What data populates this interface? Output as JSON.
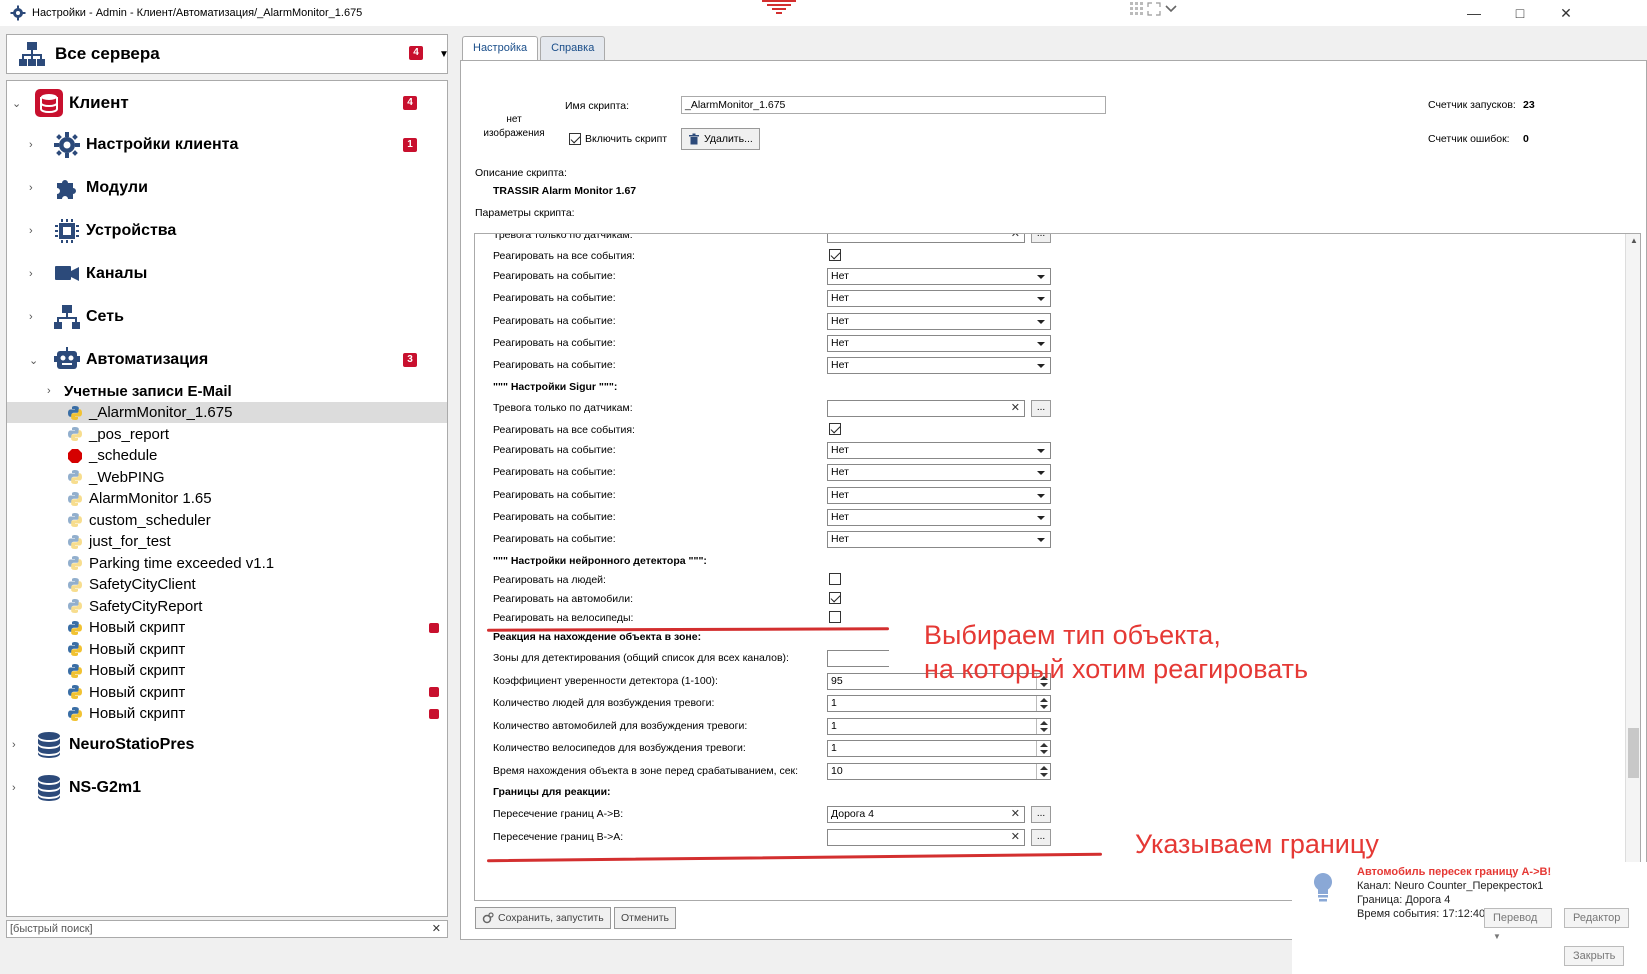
{
  "window": {
    "title": "Настройки - Admin - Клиент/Автоматизация/_AlarmMonitor_1.675"
  },
  "left_top": {
    "label": "Все сервера",
    "badge": "4"
  },
  "tree": {
    "client": {
      "label": "Клиент",
      "badge": "4"
    },
    "client_settings": {
      "label": "Настройки клиента",
      "badge": "1"
    },
    "modules": {
      "label": "Модули"
    },
    "devices": {
      "label": "Устройства"
    },
    "channels": {
      "label": "Каналы"
    },
    "network": {
      "label": "Сеть"
    },
    "automation": {
      "label": "Автоматизация",
      "badge": "3"
    },
    "email": {
      "label": "Учетные записи E-Mail"
    },
    "scripts": [
      {
        "label": "_AlarmMonitor_1.675",
        "selected": true
      },
      {
        "label": "_pos_report"
      },
      {
        "label": "_schedule"
      },
      {
        "label": "_WebPING"
      },
      {
        "label": "AlarmMonitor 1.65"
      },
      {
        "label": "custom_scheduler"
      },
      {
        "label": "just_for_test"
      },
      {
        "label": "Parking time exceeded v1.1"
      },
      {
        "label": "SafetyCityClient"
      },
      {
        "label": "SafetyCityReport"
      },
      {
        "label": "Новый скрипт",
        "flag": true
      },
      {
        "label": "Новый скрипт"
      },
      {
        "label": "Новый скрипт"
      },
      {
        "label": "Новый скрипт",
        "flag": true
      },
      {
        "label": "Новый скрипт",
        "flag": true
      }
    ],
    "server2": {
      "label": "NeuroStatioPres"
    },
    "server3": {
      "label": "NS-G2m1"
    }
  },
  "quick_search": {
    "placeholder": "[быстрый поиск]"
  },
  "tabs": {
    "settings": "Настройка",
    "help": "Справка"
  },
  "script": {
    "no_image": "нет изображения",
    "name_label": "Имя скрипта:",
    "name_value": "_AlarmMonitor_1.675",
    "enable_label": "Включить скрипт",
    "delete_label": "Удалить...",
    "run_count_label": "Счетчик запусков:",
    "run_count": "23",
    "error_count_label": "Счетчик ошибок:",
    "error_count": "0",
    "desc_label": "Описание скрипта:",
    "desc_value": "TRASSIR Alarm Monitor 1.67",
    "params_label": "Параметры скрипта:"
  },
  "params": {
    "sensors_only": "Тревога только по датчикам:",
    "all_events": "Реагировать на все события:",
    "on_event": "Реагировать на событие:",
    "none_value": "Нет",
    "sigur_header": "\"\"\" Настройки Sigur \"\"\":",
    "neuro_header": "\"\"\" Настройки нейронного детектора \"\"\":",
    "people": "Реагировать на людей:",
    "cars": "Реагировать на автомобили:",
    "bikes": "Реагировать на велосипеды:",
    "zone_reaction": "Реакция на нахождение объекта в зоне:",
    "zones": "Зоны для детектирования (общий список для всех каналов):",
    "confidence": "Коэффициент уверенности детектора (1-100):",
    "confidence_value": "95",
    "people_count": "Количество людей для возбуждения тревоги:",
    "people_count_value": "1",
    "car_count": "Количество автомобилей для возбуждения тревоги:",
    "car_count_value": "1",
    "bike_count": "Количество велосипедов для возбуждения тревоги:",
    "bike_count_value": "1",
    "zone_time": "Время нахождения объекта в зоне перед срабатыванием, сек:",
    "zone_time_value": "10",
    "borders": "Границы для реакции:",
    "ab": "Пересечение границ A->B:",
    "ab_value": "Дорога 4",
    "ba": "Пересечение границ B->A:"
  },
  "buttons": {
    "save_run": "Сохранить, запустить",
    "cancel": "Отменить"
  },
  "annotations": {
    "line1": "Выбираем тип объекта,",
    "line2": "на который хотим реагировать",
    "border": "Указываем границу"
  },
  "notification": {
    "title": "Автомобиль пересек границу A->B!",
    "channel": "Канал: Neuro Counter_Перекресток1",
    "border": "Граница: Дорога 4",
    "time": "Время события: 17:12:40",
    "translate": "Перевод",
    "editor": "Редактор",
    "close": "Закрыть"
  },
  "colors": {
    "accent_red": "#e53935",
    "badge_red": "#c8102e",
    "tab_blue": "#1a4e8a"
  }
}
